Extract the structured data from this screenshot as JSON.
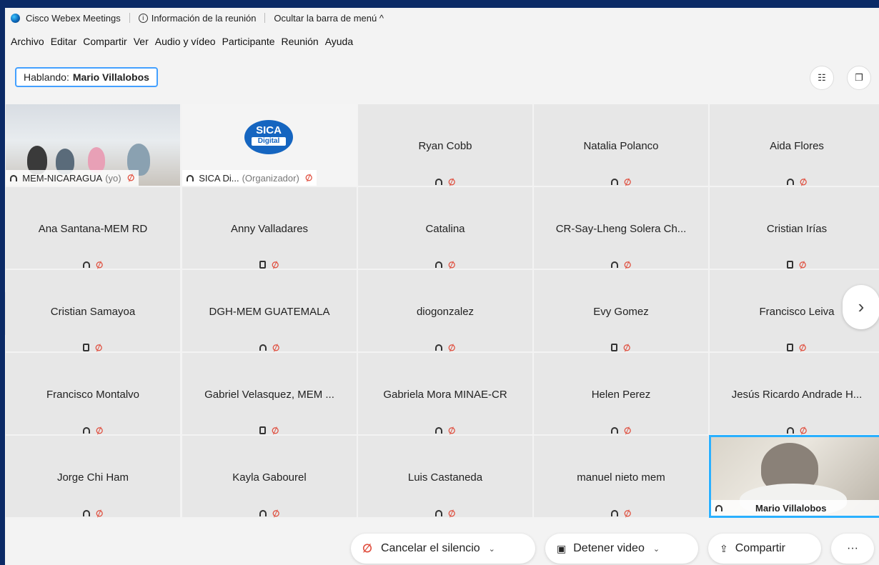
{
  "titlebar": {
    "app_name": "Cisco Webex Meetings",
    "meeting_info": "Información de la reunión",
    "hide_menu": "Ocultar la barra de menú ^"
  },
  "menu": [
    "Archivo",
    "Editar",
    "Compartir",
    "Ver",
    "Audio y vídeo",
    "Participante",
    "Reunión",
    "Ayuda"
  ],
  "speaking": {
    "prefix": "Hablando:",
    "name": "Mario Villalobos"
  },
  "participants": [
    {
      "name": "MEM-NICARAGUA",
      "tag": "(yo)",
      "type": "video"
    },
    {
      "name": "SICA Di...",
      "tag": "(Organizador)",
      "type": "logo",
      "logo_text": "SICA",
      "logo_sub": "Digital"
    },
    {
      "name": "Ryan Cobb",
      "icon": "headset"
    },
    {
      "name": "Natalia Polanco",
      "icon": "headset"
    },
    {
      "name": "Aida Flores",
      "icon": "headset"
    },
    {
      "name": "Ana Santana-MEM RD",
      "icon": "headset"
    },
    {
      "name": "Anny Valladares",
      "icon": "phone"
    },
    {
      "name": "Catalina",
      "icon": "headset"
    },
    {
      "name": "CR-Say-Lheng Solera Ch...",
      "icon": "headset"
    },
    {
      "name": "Cristian Irías",
      "icon": "phone"
    },
    {
      "name": "Cristian Samayoa",
      "icon": "phone"
    },
    {
      "name": "DGH-MEM GUATEMALA",
      "icon": "headset"
    },
    {
      "name": "diogonzalez",
      "icon": "headset"
    },
    {
      "name": "Evy Gomez",
      "icon": "phone"
    },
    {
      "name": "Francisco Leiva",
      "icon": "phone"
    },
    {
      "name": "Francisco Montalvo",
      "icon": "headset"
    },
    {
      "name": "Gabriel Velasquez, MEM ...",
      "icon": "phone"
    },
    {
      "name": "Gabriela Mora MINAE-CR",
      "icon": "headset"
    },
    {
      "name": "Helen Perez",
      "icon": "headset"
    },
    {
      "name": "Jesús Ricardo Andrade H...",
      "icon": "headset"
    },
    {
      "name": "Jorge Chi Ham",
      "icon": "headset"
    },
    {
      "name": "Kayla Gabourel",
      "icon": "headset"
    },
    {
      "name": "Luis Castaneda",
      "icon": "headset"
    },
    {
      "name": "manuel nieto mem",
      "icon": "headset"
    },
    {
      "name": "Mario Villalobos",
      "type": "video-active"
    }
  ],
  "controls": {
    "unmute": "Cancelar el silencio",
    "stop_video": "Detener video",
    "share": "Compartir",
    "more": "···"
  },
  "colors": {
    "accent": "#2ab0ff",
    "mute_red": "#e05040",
    "frame": "#0b2a66"
  }
}
